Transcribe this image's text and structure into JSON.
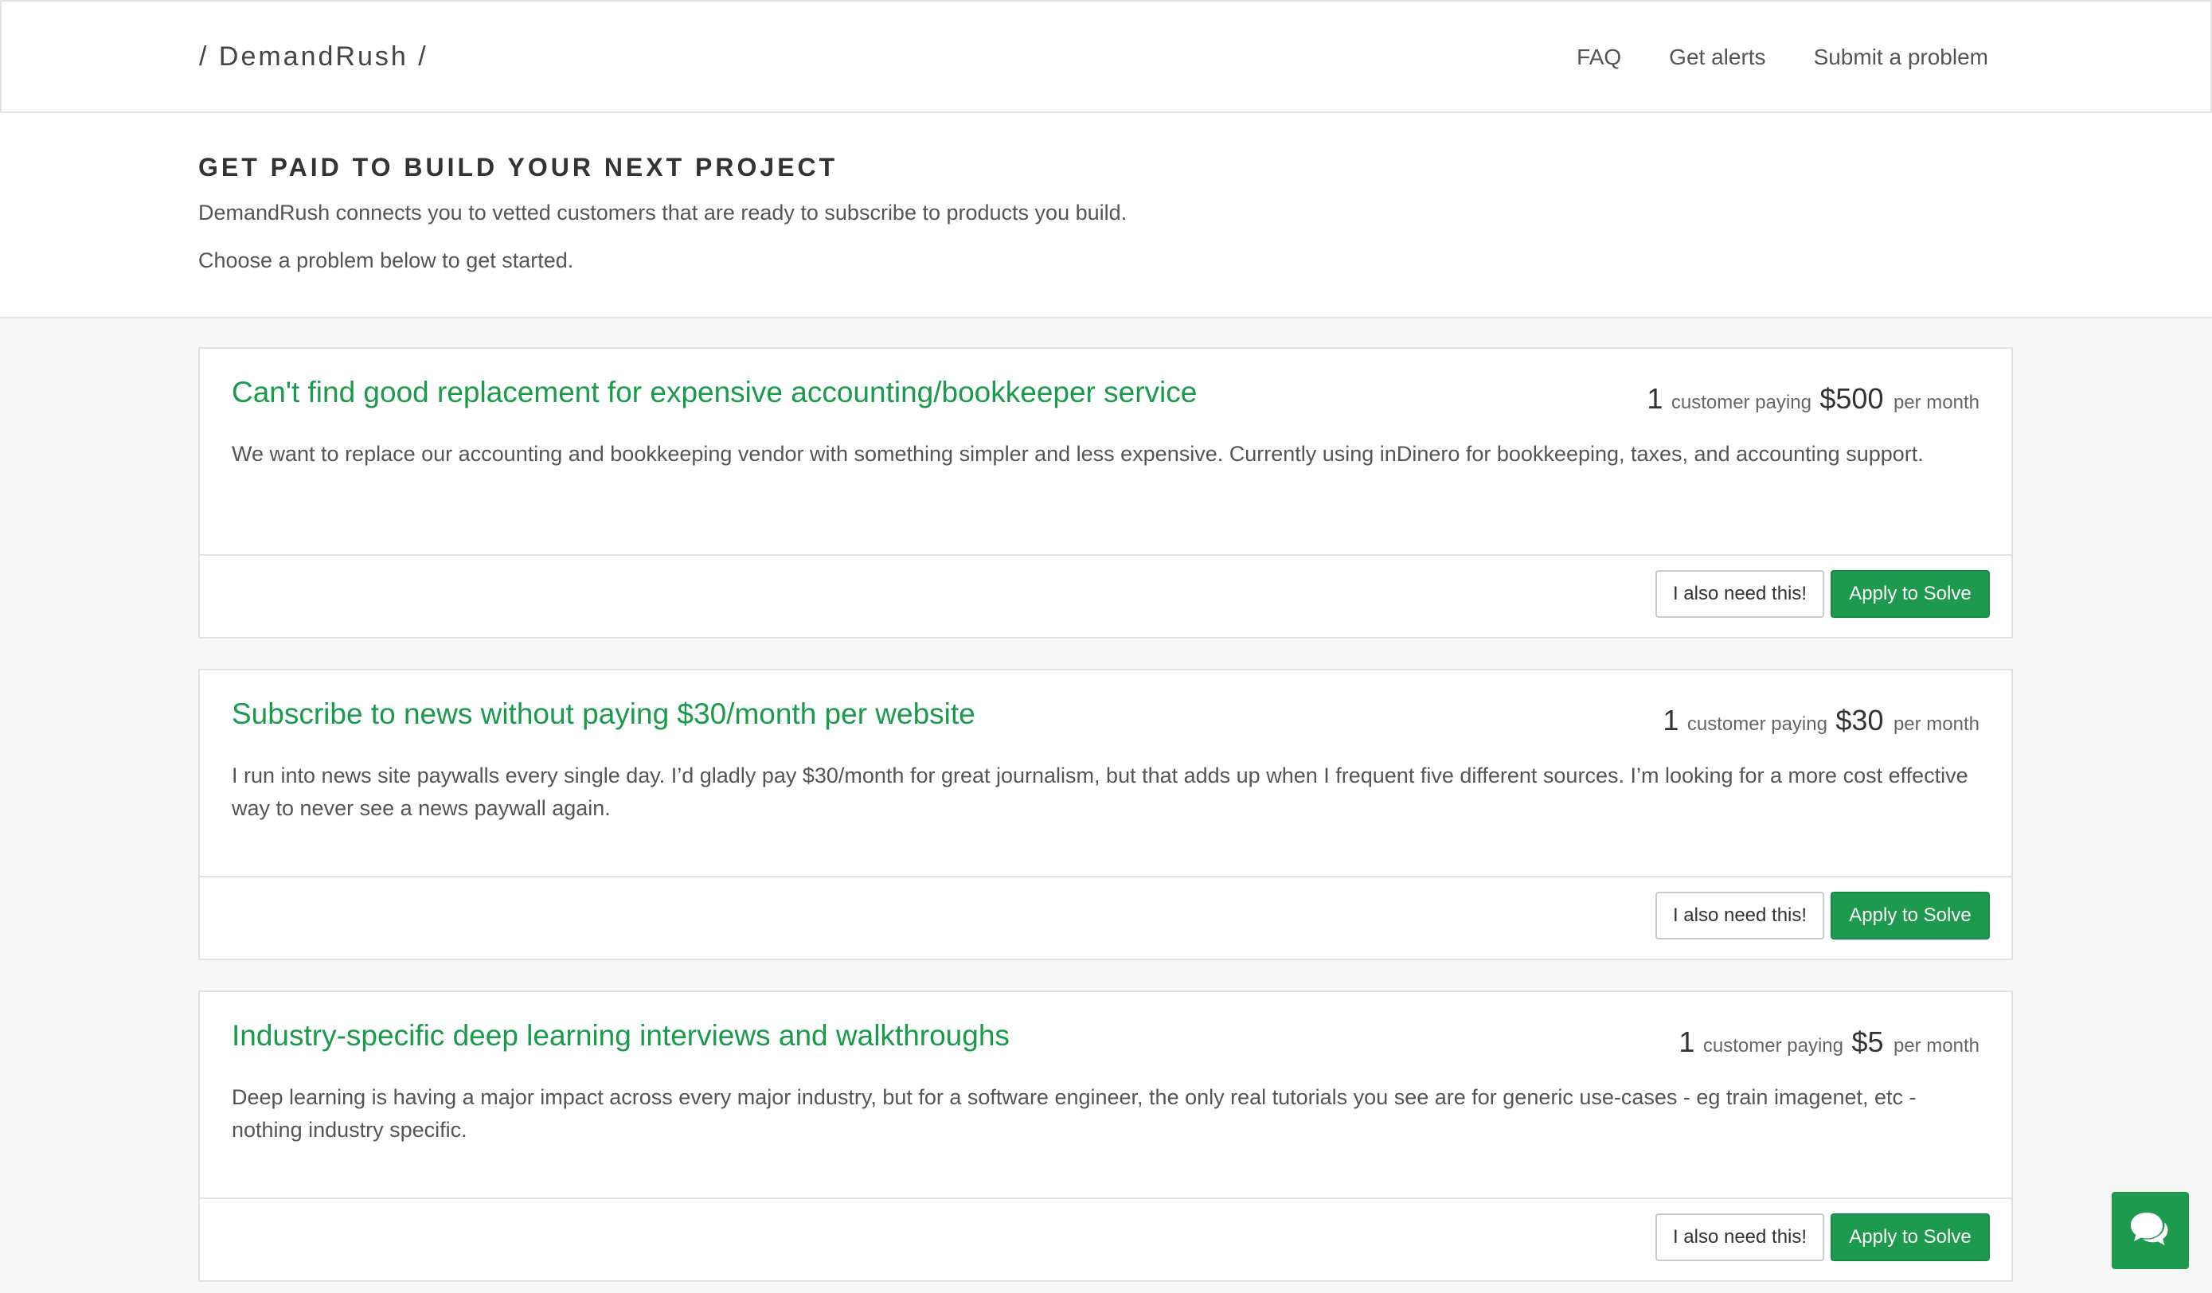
{
  "nav": {
    "brand": "/ DemandRush /",
    "links": [
      {
        "label": "FAQ"
      },
      {
        "label": "Get alerts"
      },
      {
        "label": "Submit a problem"
      }
    ]
  },
  "hero": {
    "heading": "GET PAID TO BUILD YOUR NEXT PROJECT",
    "line1": "DemandRush connects you to vetted customers that are ready to subscribe to products you build.",
    "line2": "Choose a problem below to get started."
  },
  "problems": [
    {
      "title": "Can't find good replacement for expensive accounting/bookkeeper service",
      "customers": "1",
      "customer_label": "customer paying",
      "amount": "$500",
      "period": "per month",
      "description": "We want to replace our accounting and bookkeeping vendor with something simpler and less expensive. Currently using inDinero for bookkeeping, taxes, and accounting support.",
      "need_label": "I also need this!",
      "apply_label": "Apply to Solve"
    },
    {
      "title": "Subscribe to news without paying $30/month per website",
      "customers": "1",
      "customer_label": "customer paying",
      "amount": "$30",
      "period": "per month",
      "description": "I run into news site paywalls every single day. I’d gladly pay $30/month for great journalism, but that adds up when I frequent five different sources. I’m looking for a more cost effective way to never see a news paywall again.",
      "need_label": "I also need this!",
      "apply_label": "Apply to Solve"
    },
    {
      "title": "Industry-specific deep learning interviews and walkthroughs",
      "customers": "1",
      "customer_label": "customer paying",
      "amount": "$5",
      "period": "per month",
      "description": "Deep learning is having a major impact across every major industry, but for a software engineer, the only real tutorials you see are for generic use-cases - eg train imagenet, etc - nothing industry specific.",
      "need_label": "I also need this!",
      "apply_label": "Apply to Solve"
    }
  ],
  "chat": {
    "icon": "chat-bubbles-icon",
    "color": "#1e9a4f"
  },
  "colors": {
    "accent": "#1e9a4f",
    "title_green": "#1a9a4b",
    "page_bg": "#f7f7f7"
  }
}
